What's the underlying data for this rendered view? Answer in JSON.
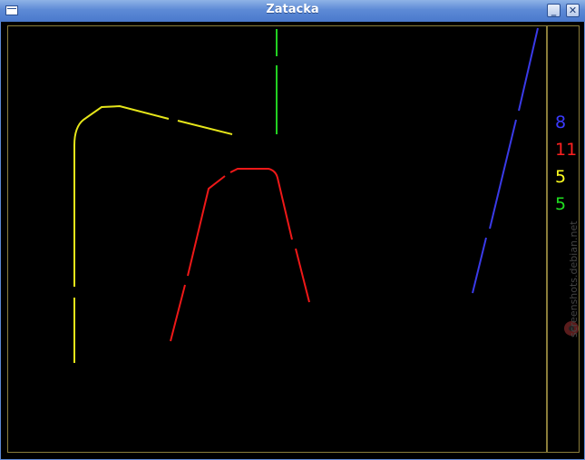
{
  "window": {
    "title": "Zatacka"
  },
  "controls": {
    "minimize_glyph": "_",
    "close_glyph": "✕"
  },
  "scores": [
    {
      "value": "8",
      "color": "#3a3aff"
    },
    {
      "value": "11",
      "color": "#ff2020"
    },
    {
      "value": "5",
      "color": "#ffff20"
    },
    {
      "value": "5",
      "color": "#20e020"
    }
  ],
  "watermark": {
    "text": "screenshots.debian.net"
  }
}
